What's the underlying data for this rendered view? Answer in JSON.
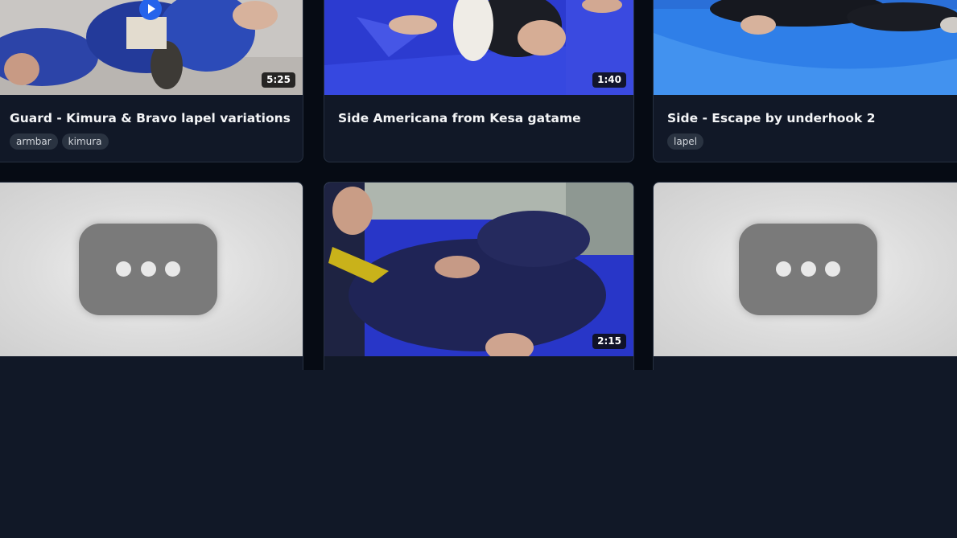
{
  "videos": [
    {
      "title": "Guard - Kimura & Bravo lapel variations",
      "duration": "5:25",
      "tags": [
        "armbar",
        "kimura"
      ]
    },
    {
      "title": "Side Americana from Kesa gatame",
      "duration": "1:40",
      "tags": []
    },
    {
      "title": "Side - Escape by underhook 2",
      "duration": "",
      "tags": [
        "lapel"
      ]
    },
    {
      "title": "",
      "duration": "",
      "tags": []
    },
    {
      "title": "",
      "duration": "2:15",
      "tags": []
    },
    {
      "title": "",
      "duration": "",
      "tags": []
    }
  ],
  "colors": {
    "page_bg": "#111827",
    "grid_bg": "#060b14",
    "card_bg": "#111827",
    "play_button": "#2563eb",
    "mat_blue": "#2f3fd6",
    "tag_bg": "#2a3341"
  },
  "icons": {
    "play": "play-icon",
    "loading": "loading-ellipsis-icon"
  }
}
